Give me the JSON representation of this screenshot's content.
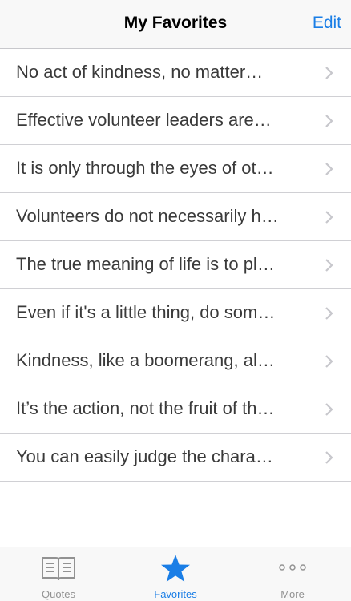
{
  "navbar": {
    "title": "My Favorites",
    "edit_label": "Edit"
  },
  "favorites": [
    "No act of kindness, no matter…",
    "Effective volunteer leaders are…",
    "It is only through the eyes of ot…",
    "Volunteers do not necessarily h…",
    "The true meaning of life is to pl…",
    "Even if it's a little thing, do som…",
    "Kindness, like a boomerang, al…",
    "It’s the action, not the fruit of th…",
    "You can easily judge the chara…"
  ],
  "tabbar": {
    "tabs": [
      {
        "label": "Quotes",
        "icon": "book-icon",
        "active": false
      },
      {
        "label": "Favorites",
        "icon": "star-icon",
        "active": true
      },
      {
        "label": "More",
        "icon": "more-dots-icon",
        "active": false
      }
    ]
  },
  "colors": {
    "accent": "#1a7ee6",
    "inactive": "#929292",
    "text": "#3a3a3a"
  }
}
